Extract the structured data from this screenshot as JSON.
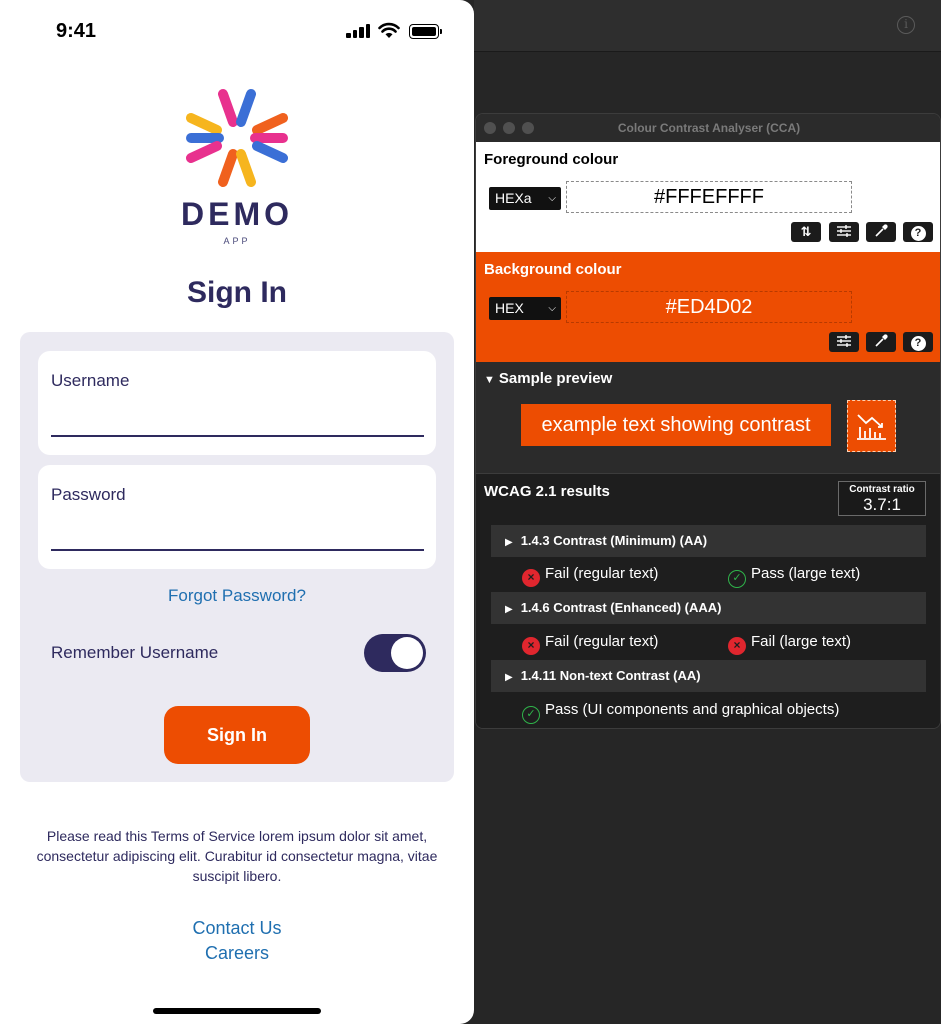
{
  "status": {
    "time": "9:41"
  },
  "logo": {
    "word": "DEMO",
    "sub": "APP"
  },
  "signin": {
    "title": "Sign In",
    "username_label": "Username",
    "password_label": "Password",
    "forgot": "Forgot Password?",
    "remember": "Remember Username",
    "button": "Sign In"
  },
  "footer": {
    "terms": "Please read this Terms of Service lorem ipsum dolor sit amet, consectetur adipiscing elit. Curabitur id consectetur magna, vitae suscipit libero.",
    "contact": "Contact Us",
    "careers": "Careers"
  },
  "cca": {
    "title": "Colour Contrast Analyser (CCA)",
    "foreground": {
      "label": "Foreground colour",
      "format": "HEXa",
      "value": "#FFFEFFFF"
    },
    "background": {
      "label": "Background colour",
      "format": "HEX",
      "value": "#ED4D02"
    },
    "preview": {
      "label": "Sample preview",
      "text": "example text showing contrast"
    },
    "wcag": {
      "label": "WCAG 2.1 results",
      "ratio_label": "Contrast ratio",
      "ratio_value": "3.7:1",
      "criteria": [
        {
          "title": "1.4.3 Contrast (Minimum) (AA)",
          "results": [
            "Fail (regular text)",
            "Pass (large text)"
          ]
        },
        {
          "title": "1.4.6 Contrast (Enhanced) (AAA)",
          "results": [
            "Fail (regular text)",
            "Fail (large text)"
          ]
        },
        {
          "title": "1.4.11 Non-text Contrast (AA)",
          "results": [
            "Pass (UI components and graphical objects)"
          ]
        }
      ]
    }
  },
  "colors": {
    "accent": "#ED4D02",
    "navy": "#2E2A5E",
    "link": "#1F6FB0",
    "pass": "#2FB34A",
    "fail": "#E0262E"
  }
}
